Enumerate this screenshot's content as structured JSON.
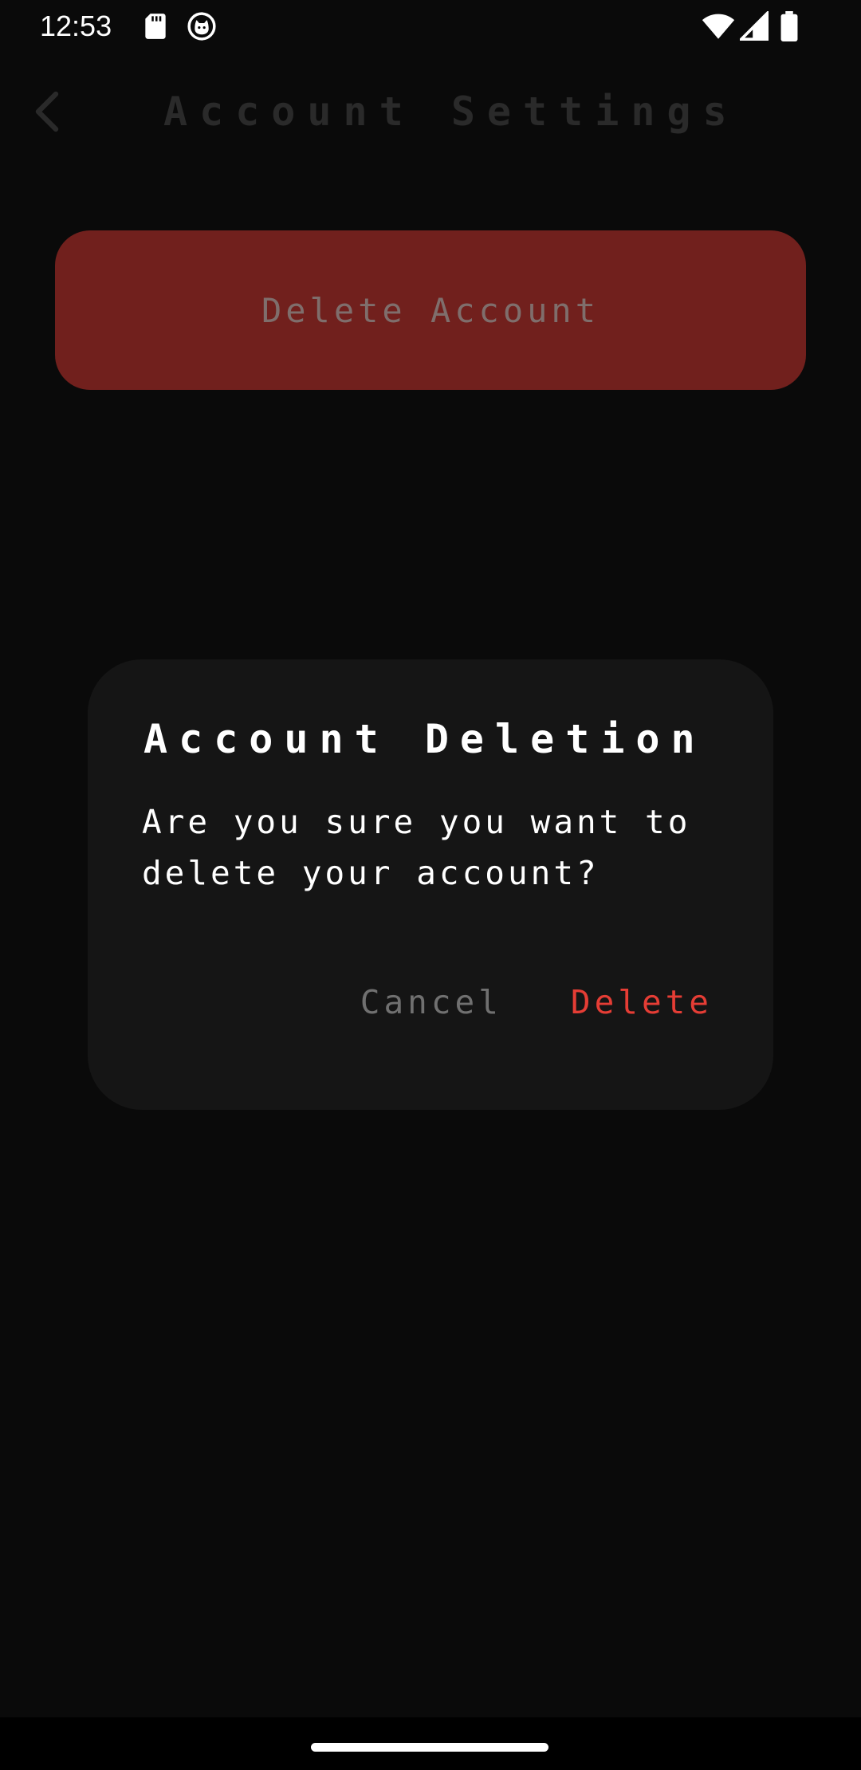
{
  "status_bar": {
    "time": "12:53",
    "left_icons": [
      "sd-card-icon",
      "cat-face-icon"
    ],
    "right_icons": [
      "wifi-icon",
      "cell-signal-icon",
      "battery-icon"
    ]
  },
  "app_bar": {
    "back_icon": "chevron-left-icon",
    "title": "Account Settings"
  },
  "main": {
    "delete_account_label": "Delete Account"
  },
  "dialog": {
    "title": "Account Deletion",
    "message": "Are you sure you want to delete your account?",
    "cancel_label": "Cancel",
    "delete_label": "Delete"
  },
  "colors": {
    "background": "#0a0a0a",
    "dialog_background": "#151515",
    "delete_button_background": "#71201d",
    "destructive_text": "#e53d35",
    "muted_text": "#707070"
  }
}
